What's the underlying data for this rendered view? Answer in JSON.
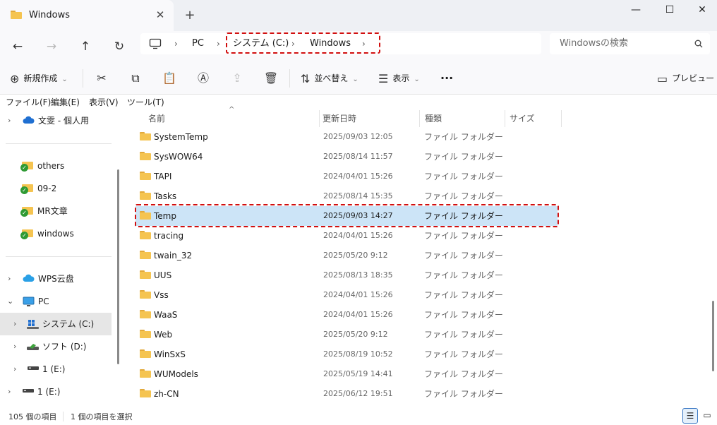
{
  "tab": {
    "title": "Windows",
    "close_glyph": "✕",
    "new_glyph": "+"
  },
  "window_controls": {
    "minimize": "—",
    "maximize": "☐",
    "close": "✕"
  },
  "nav": {
    "back": "←",
    "forward": "→",
    "up": "↑",
    "refresh": "↻"
  },
  "breadcrumb": {
    "root_icon": "monitor-icon",
    "items": [
      "PC",
      "システム (C:)",
      "Windows"
    ],
    "sep": "›"
  },
  "search": {
    "placeholder": "Windowsの検索"
  },
  "toolbar": {
    "new_label": "新規作成",
    "sort_label": "並べ替え",
    "view_label": "表示",
    "more_label": "···",
    "preview_label": "プレビュー"
  },
  "menubar": [
    "ファイル(F)",
    "編集(E)",
    "表示(V)",
    "ツール(T)"
  ],
  "sidebar": {
    "items": [
      {
        "label": "文雯 - 個人用",
        "icon": "cloud-icon"
      },
      {
        "label": "others",
        "icon": "synced-folder-icon"
      },
      {
        "label": "09-2",
        "icon": "synced-folder-icon"
      },
      {
        "label": "MR文章",
        "icon": "synced-folder-icon"
      },
      {
        "label": "windows",
        "icon": "synced-folder-icon"
      },
      {
        "label": "WPS云盘",
        "icon": "cloud-icon"
      },
      {
        "label": "PC",
        "icon": "monitor-icon"
      },
      {
        "label": "システム (C:)",
        "icon": "windows-drive-icon",
        "selected": true
      },
      {
        "label": "ソフト (D:)",
        "icon": "drive-icon"
      },
      {
        "label": "1 (E:)",
        "icon": "usb-drive-icon"
      },
      {
        "label": "1 (E:)",
        "icon": "usb-drive-icon"
      }
    ]
  },
  "columns": {
    "name": "名前",
    "date": "更新日時",
    "type": "種類",
    "size": "サイズ"
  },
  "files": [
    {
      "name": "SystemTemp",
      "date": "2025/09/03 12:05",
      "type": "ファイル フォルダー"
    },
    {
      "name": "SysWOW64",
      "date": "2025/08/14 11:57",
      "type": "ファイル フォルダー"
    },
    {
      "name": "TAPI",
      "date": "2024/04/01 15:26",
      "type": "ファイル フォルダー"
    },
    {
      "name": "Tasks",
      "date": "2025/08/14 15:35",
      "type": "ファイル フォルダー"
    },
    {
      "name": "Temp",
      "date": "2025/09/03 14:27",
      "type": "ファイル フォルダー",
      "selected": true
    },
    {
      "name": "tracing",
      "date": "2024/04/01 15:26",
      "type": "ファイル フォルダー"
    },
    {
      "name": "twain_32",
      "date": "2025/05/20 9:12",
      "type": "ファイル フォルダー"
    },
    {
      "name": "UUS",
      "date": "2025/08/13 18:35",
      "type": "ファイル フォルダー"
    },
    {
      "name": "Vss",
      "date": "2024/04/01 15:26",
      "type": "ファイル フォルダー"
    },
    {
      "name": "WaaS",
      "date": "2024/04/01 15:26",
      "type": "ファイル フォルダー"
    },
    {
      "name": "Web",
      "date": "2025/05/20 9:12",
      "type": "ファイル フォルダー"
    },
    {
      "name": "WinSxS",
      "date": "2025/08/19 10:52",
      "type": "ファイル フォルダー"
    },
    {
      "name": "WUModels",
      "date": "2025/05/19 14:41",
      "type": "ファイル フォルダー"
    },
    {
      "name": "zh-CN",
      "date": "2025/06/12 19:51",
      "type": "ファイル フォルダー"
    }
  ],
  "status": {
    "count": "105 個の項目",
    "selection": "1 個の項目を選択"
  },
  "colors": {
    "highlight": "#d10f0f",
    "selection": "#cce4f7",
    "accent": "#3a78c4"
  }
}
